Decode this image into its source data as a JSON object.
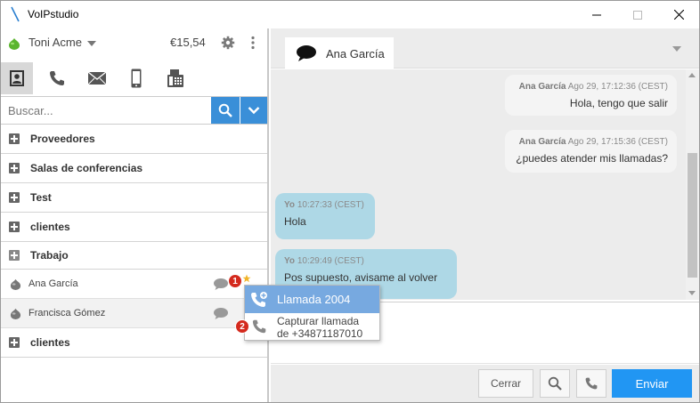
{
  "window": {
    "title": "VoIPstudio",
    "controls": [
      "minimize",
      "maximize",
      "close"
    ]
  },
  "account": {
    "name": "Toni Acme",
    "balance": "€15,54",
    "status_color": "#5bb52e"
  },
  "tabs": [
    {
      "icon": "contacts-icon",
      "active": true
    },
    {
      "icon": "phone-icon",
      "active": false
    },
    {
      "icon": "mail-icon",
      "active": false
    },
    {
      "icon": "mobile-icon",
      "active": false
    },
    {
      "icon": "fax-icon",
      "active": false
    }
  ],
  "search": {
    "placeholder": "Buscar..."
  },
  "groups": [
    {
      "label": "Proveedores"
    },
    {
      "label": "Salas de conferencias"
    },
    {
      "label": "Test"
    },
    {
      "label": "clientes"
    },
    {
      "label": "Trabajo"
    }
  ],
  "contacts": [
    {
      "name": "Ana García"
    },
    {
      "name": "Francisca Gómez"
    }
  ],
  "last_group": {
    "label": "clientes"
  },
  "popup": {
    "item1": "Llamada 2004",
    "item2_line1": "Capturar llamada",
    "item2_line2": "de +34871187010",
    "badge1": "1",
    "badge2": "2"
  },
  "conversation": {
    "tab_label": "Ana García",
    "messages": [
      {
        "direction": "in",
        "sender": "Ana García",
        "time": "Ago 29, 17:12:36 (CEST)",
        "text": "Hola, tengo que salir"
      },
      {
        "direction": "in",
        "sender": "Ana García",
        "time": "Ago 29, 17:15:36 (CEST)",
        "text": "¿puedes atender mis llamadas?"
      },
      {
        "direction": "out",
        "sender": "Yo",
        "time": "10:27:33 (CEST)",
        "text": "Hola"
      },
      {
        "direction": "out",
        "sender": "Yo",
        "time": "10:29:49 (CEST)",
        "text": "Pos supuesto, avisame al volver"
      }
    ]
  },
  "footer": {
    "close_label": "Cerrar",
    "send_label": "Enviar"
  },
  "colors": {
    "accent": "#3a8fd8",
    "send": "#2196f3",
    "outgoing_bubble": "#aed8e6",
    "badge": "#d42a1e"
  }
}
